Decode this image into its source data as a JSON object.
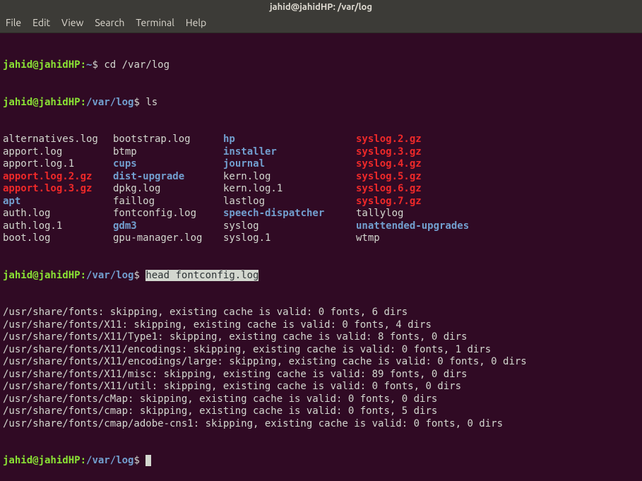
{
  "titlebar": "jahid@jahidHP: /var/log",
  "menu": [
    "File",
    "Edit",
    "View",
    "Search",
    "Terminal",
    "Help"
  ],
  "prompt1": {
    "user": "jahid@jahidHP",
    "sep": ":",
    "path": "~",
    "dollar": "$",
    "cmd": "cd /var/log"
  },
  "prompt2": {
    "user": "jahid@jahidHP",
    "sep": ":",
    "path": "/var/log",
    "dollar": "$",
    "cmd": "ls"
  },
  "ls_rows": [
    [
      {
        "t": "alternatives.log",
        "c": "c-white"
      },
      {
        "t": "bootstrap.log",
        "c": "c-white"
      },
      {
        "t": "hp",
        "c": "c-blue"
      },
      {
        "t": "syslog.2.gz",
        "c": "c-red"
      }
    ],
    [
      {
        "t": "apport.log",
        "c": "c-white"
      },
      {
        "t": "btmp",
        "c": "c-white"
      },
      {
        "t": "installer",
        "c": "c-blue"
      },
      {
        "t": "syslog.3.gz",
        "c": "c-red"
      }
    ],
    [
      {
        "t": "apport.log.1",
        "c": "c-white"
      },
      {
        "t": "cups",
        "c": "c-blue"
      },
      {
        "t": "journal",
        "c": "c-blue"
      },
      {
        "t": "syslog.4.gz",
        "c": "c-red"
      }
    ],
    [
      {
        "t": "apport.log.2.gz",
        "c": "c-red"
      },
      {
        "t": "dist-upgrade",
        "c": "c-blue"
      },
      {
        "t": "kern.log",
        "c": "c-white"
      },
      {
        "t": "syslog.5.gz",
        "c": "c-red"
      }
    ],
    [
      {
        "t": "apport.log.3.gz",
        "c": "c-red"
      },
      {
        "t": "dpkg.log",
        "c": "c-white"
      },
      {
        "t": "kern.log.1",
        "c": "c-white"
      },
      {
        "t": "syslog.6.gz",
        "c": "c-red"
      }
    ],
    [
      {
        "t": "apt",
        "c": "c-blue"
      },
      {
        "t": "faillog",
        "c": "c-white"
      },
      {
        "t": "lastlog",
        "c": "c-white"
      },
      {
        "t": "syslog.7.gz",
        "c": "c-red"
      }
    ],
    [
      {
        "t": "auth.log",
        "c": "c-white"
      },
      {
        "t": "fontconfig.log",
        "c": "c-white"
      },
      {
        "t": "speech-dispatcher",
        "c": "c-blue"
      },
      {
        "t": "tallylog",
        "c": "c-white"
      }
    ],
    [
      {
        "t": "auth.log.1",
        "c": "c-white"
      },
      {
        "t": "gdm3",
        "c": "c-blue"
      },
      {
        "t": "syslog",
        "c": "c-white"
      },
      {
        "t": "unattended-upgrades",
        "c": "c-blue"
      }
    ],
    [
      {
        "t": "boot.log",
        "c": "c-white"
      },
      {
        "t": "gpu-manager.log",
        "c": "c-white"
      },
      {
        "t": "syslog.1",
        "c": "c-white"
      },
      {
        "t": "wtmp",
        "c": "c-white"
      }
    ]
  ],
  "prompt3": {
    "user": "jahid@jahidHP",
    "sep": ":",
    "path": "/var/log",
    "dollar": "$ ",
    "cmd_hl": "head fontconfig.log"
  },
  "output": [
    "/usr/share/fonts: skipping, existing cache is valid: 0 fonts, 6 dirs",
    "/usr/share/fonts/X11: skipping, existing cache is valid: 0 fonts, 4 dirs",
    "/usr/share/fonts/X11/Type1: skipping, existing cache is valid: 8 fonts, 0 dirs",
    "/usr/share/fonts/X11/encodings: skipping, existing cache is valid: 0 fonts, 1 dirs",
    "/usr/share/fonts/X11/encodings/large: skipping, existing cache is valid: 0 fonts, 0 dirs",
    "/usr/share/fonts/X11/misc: skipping, existing cache is valid: 89 fonts, 0 dirs",
    "/usr/share/fonts/X11/util: skipping, existing cache is valid: 0 fonts, 0 dirs",
    "/usr/share/fonts/cMap: skipping, existing cache is valid: 0 fonts, 0 dirs",
    "/usr/share/fonts/cmap: skipping, existing cache is valid: 0 fonts, 5 dirs",
    "/usr/share/fonts/cmap/adobe-cns1: skipping, existing cache is valid: 0 fonts, 0 dirs"
  ],
  "prompt4": {
    "user": "jahid@jahidHP",
    "sep": ":",
    "path": "/var/log",
    "dollar": "$ "
  }
}
